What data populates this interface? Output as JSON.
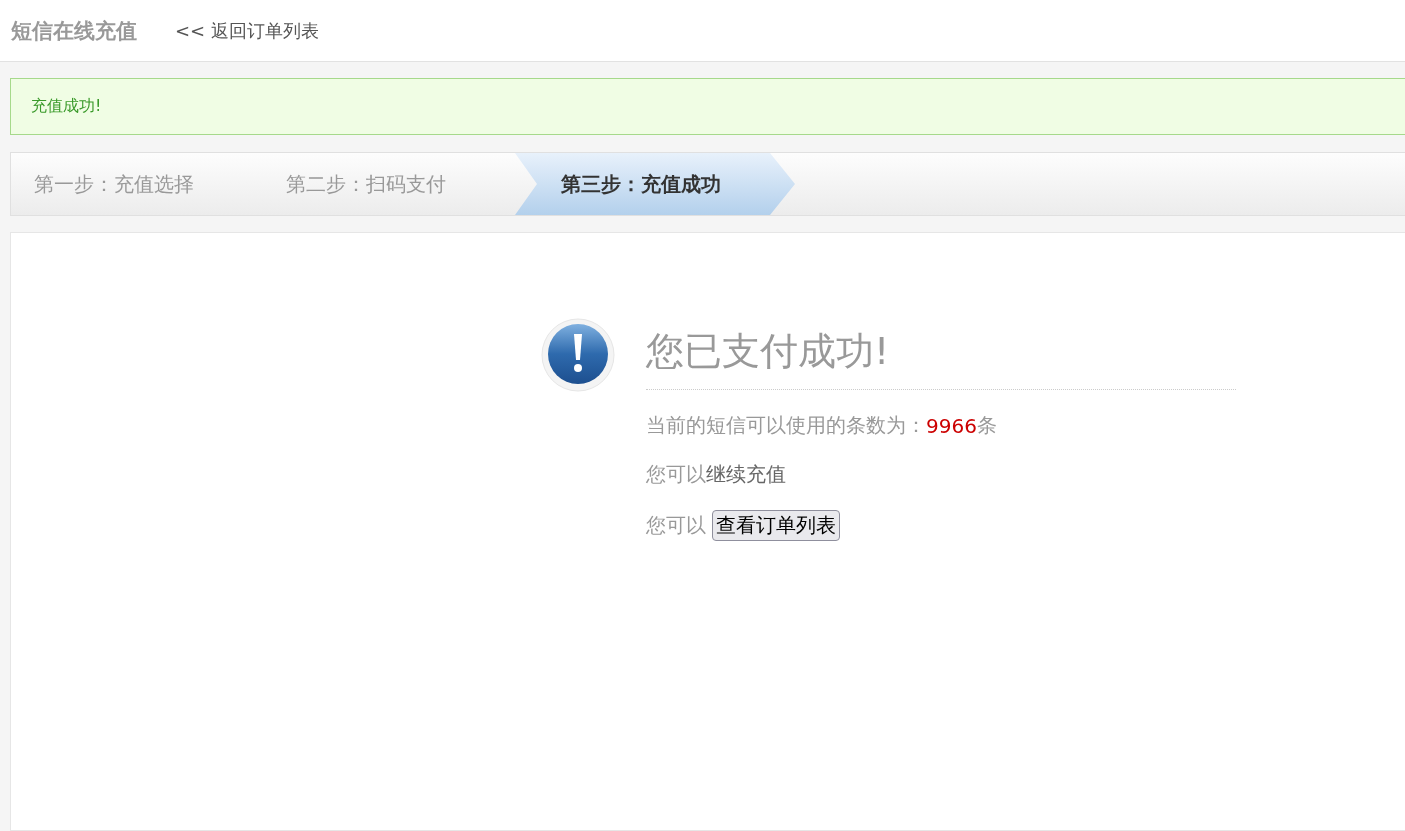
{
  "header": {
    "title": "短信在线充值",
    "back_link": "<< 返回订单列表"
  },
  "alert": {
    "message": "充值成功!"
  },
  "steps": [
    {
      "label": "第一步：充值选择",
      "selected": false
    },
    {
      "label": "第二步：扫码支付",
      "selected": false
    },
    {
      "label": "第三步：充值成功",
      "selected": true
    }
  ],
  "result": {
    "title": "您已支付成功!",
    "balance_label": "当前的短信可以使用的条数为：",
    "balance_count": "9966",
    "balance_unit": "条",
    "recharge_prefix": "您可以",
    "recharge_link": "继续充值",
    "orders_prefix": "您可以",
    "orders_button": "查看订单列表"
  }
}
